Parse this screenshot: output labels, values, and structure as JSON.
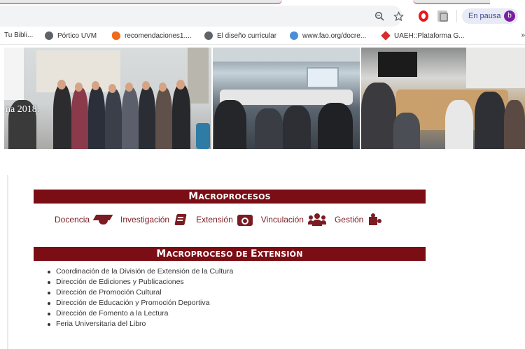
{
  "browser": {
    "status_label": "En pausa",
    "avatar_letter": "b",
    "accent": "#7b1fa2"
  },
  "bookmarks": [
    {
      "label": "Tu Bibli...",
      "icon": "none"
    },
    {
      "label": "Pórtico UVM",
      "icon": "globe-icon"
    },
    {
      "label": "recomendaciones1....",
      "icon": "orange-swirl-icon"
    },
    {
      "label": "El diseño curricular",
      "icon": "globe-icon"
    },
    {
      "label": "www.fao.org/docre...",
      "icon": "world-icon"
    },
    {
      "label": "UAEH::Plataforma G...",
      "icon": "uaeh-icon"
    }
  ],
  "carousel": {
    "caption": "na 2018.",
    "slide_count": 18,
    "active_slide": 1
  },
  "macroprocesos": {
    "title_first": "M",
    "title_rest": "ACROPROCESOS",
    "items": [
      {
        "label": "Docencia",
        "icon": "graduation-cap-icon"
      },
      {
        "label": "Investigación",
        "icon": "book-icon"
      },
      {
        "label": "Extensión",
        "icon": "camera-icon"
      },
      {
        "label": "Vinculación",
        "icon": "group-icon"
      },
      {
        "label": "Gestión",
        "icon": "puzzle-icon"
      }
    ]
  },
  "extension": {
    "title_first": "M",
    "title_mid": "ACROPROCESO DE ",
    "title_first2": "E",
    "title_rest": "XTENSIÓN",
    "items": [
      "Coordinación de la División de Extensión de la Cultura",
      "Dirección de Ediciones y Publicaciones",
      "Dirección de Promoción Cultural",
      "Dirección de Educación y Promoción Deportiva",
      "Dirección de Fomento a la Lectura",
      "Feria Universitaria del Libro"
    ]
  },
  "colors": {
    "brand": "#7b0d15",
    "link": "#7b1c22"
  }
}
